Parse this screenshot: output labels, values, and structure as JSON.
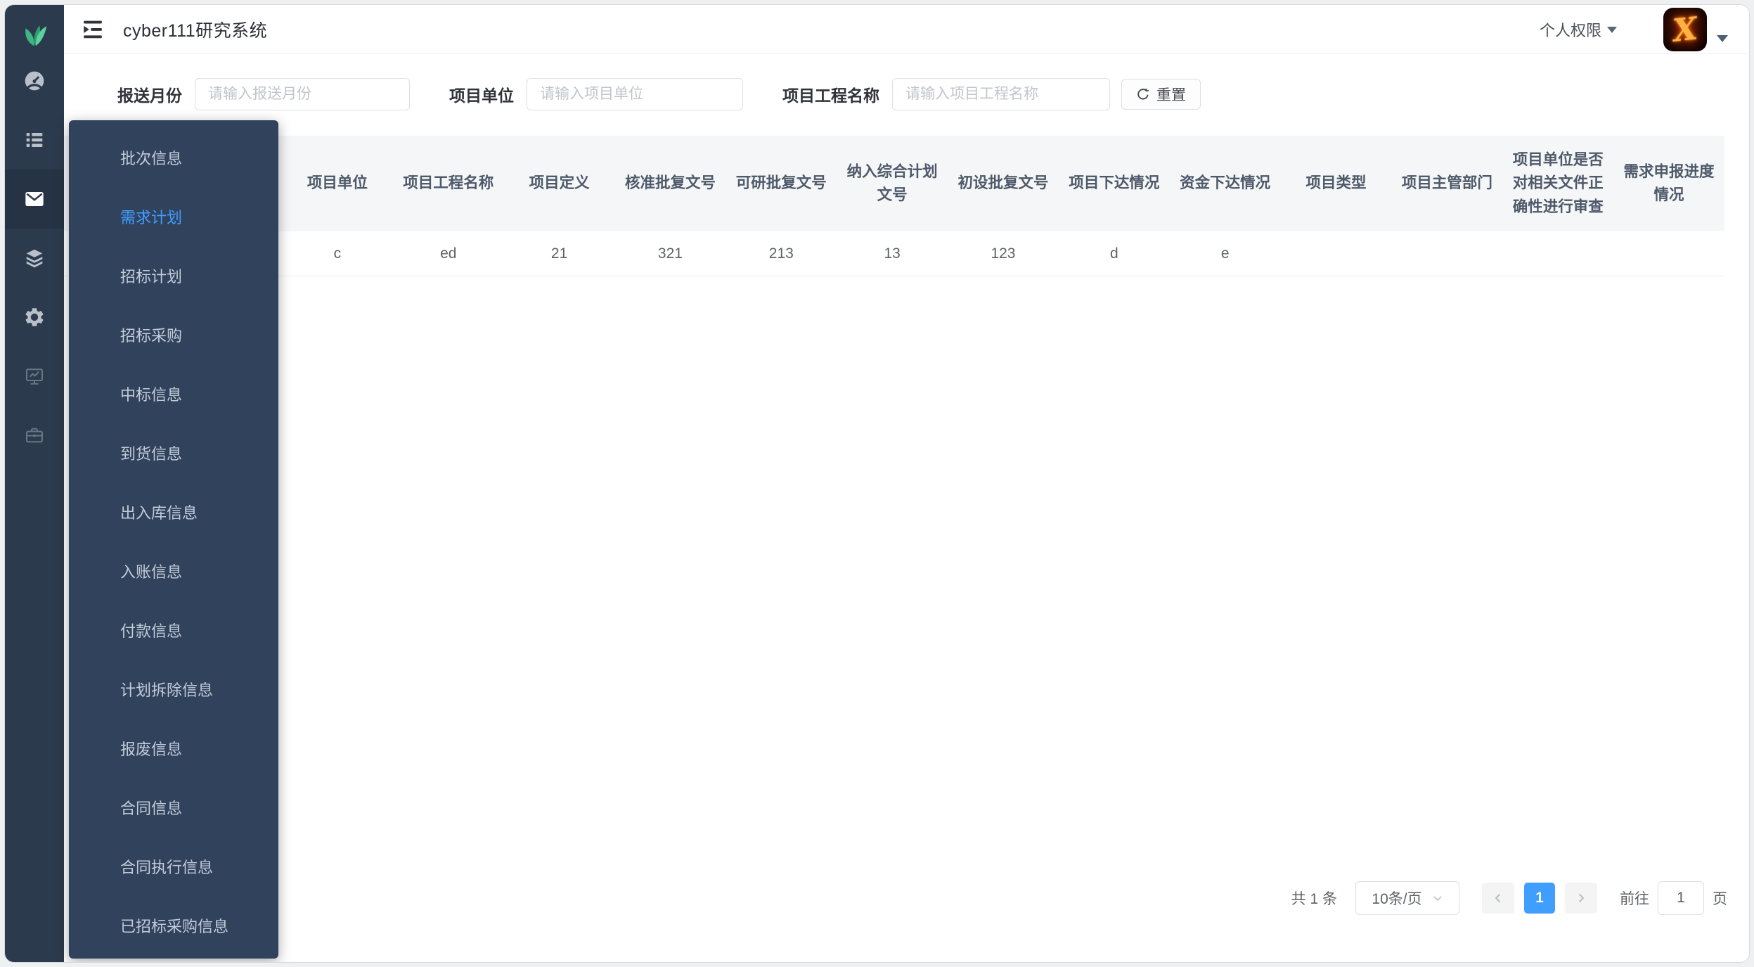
{
  "colors": {
    "accent": "#409eff",
    "sidebar_bg": "#2c3a4d",
    "sidebar_active_bg": "#263344",
    "flyout_bg": "#30425c",
    "table_header_bg": "#f5f6f8",
    "menu_text": "#c3ccd8"
  },
  "header": {
    "title": "cyber111研究系统",
    "hamburger_icon": "hamburger-icon",
    "user_menu_label": "个人权限",
    "avatar_letter": "X"
  },
  "sidebar": {
    "logo_icon": "leaf-logo",
    "items": [
      {
        "name": "dashboard",
        "active": false,
        "dim": false
      },
      {
        "name": "list",
        "active": false,
        "dim": false
      },
      {
        "name": "mail",
        "active": true,
        "dim": false
      },
      {
        "name": "layers",
        "active": false,
        "dim": false
      },
      {
        "name": "gear",
        "active": false,
        "dim": false
      },
      {
        "name": "monitor-chart",
        "active": false,
        "dim": true
      },
      {
        "name": "briefcase",
        "active": false,
        "dim": true
      }
    ]
  },
  "menu": {
    "items": [
      {
        "label": "批次信息",
        "active": false
      },
      {
        "label": "需求计划",
        "active": true
      },
      {
        "label": "招标计划",
        "active": false
      },
      {
        "label": "招标采购",
        "active": false
      },
      {
        "label": "中标信息",
        "active": false
      },
      {
        "label": "到货信息",
        "active": false
      },
      {
        "label": "出入库信息",
        "active": false
      },
      {
        "label": "入账信息",
        "active": false
      },
      {
        "label": "付款信息",
        "active": false
      },
      {
        "label": "计划拆除信息",
        "active": false
      },
      {
        "label": "报废信息",
        "active": false
      },
      {
        "label": "合同信息",
        "active": false
      },
      {
        "label": "合同执行信息",
        "active": false
      },
      {
        "label": "已招标采购信息",
        "active": false
      }
    ]
  },
  "filters": {
    "fields": [
      {
        "label": "报送月份",
        "placeholder": "请输入报送月份",
        "value": ""
      },
      {
        "label": "项目单位",
        "placeholder": "请输入项目单位",
        "value": ""
      },
      {
        "label": "项目工程名称",
        "placeholder": "请输入项目工程名称",
        "value": ""
      }
    ],
    "reset_label": "重置",
    "reset_icon": "refresh-icon"
  },
  "table": {
    "columns": [
      "项目单位",
      "项目工程名称",
      "项目定义",
      "核准批复文号",
      "可研批复文号",
      "纳入综合计划文号",
      "初设批复文号",
      "项目下达情况",
      "资金下达情况",
      "项目类型",
      "项目主管部门",
      "项目单位是否对相关文件正确性进行审查",
      "需求申报进度情况"
    ],
    "rows": [
      [
        "c",
        "ed",
        "21",
        "321",
        "213",
        "13",
        "123",
        "d",
        "e",
        "",
        "",
        "",
        ""
      ]
    ]
  },
  "pagination": {
    "total_text": "共 1 条",
    "page_size_label": "10条/页",
    "pages": [
      "1"
    ],
    "current_page": "1",
    "goto_label": "前往",
    "goto_value": "1",
    "page_unit": "页"
  }
}
